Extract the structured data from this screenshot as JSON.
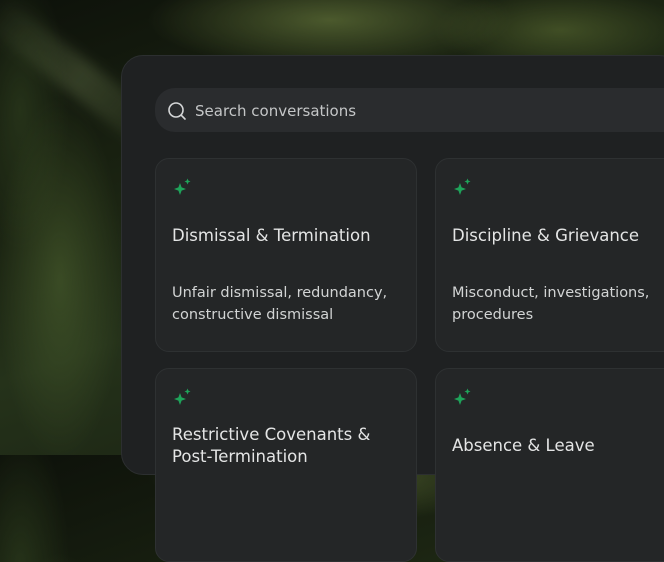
{
  "search": {
    "placeholder": "Search conversations"
  },
  "topics": [
    {
      "title": "Dismissal & Termination",
      "description": "Unfair dismissal, redundancy, constructive dismissal",
      "icon": "sparkle-icon"
    },
    {
      "title": "Discipline & Grievance",
      "description": "Misconduct, investigations, procedures",
      "icon": "sparkle-icon"
    },
    {
      "title": "Restrictive Covenants & Post-Termination",
      "description": "",
      "icon": "sparkle-icon"
    },
    {
      "title": "Absence & Leave",
      "description": "",
      "icon": "sparkle-icon"
    }
  ],
  "colors": {
    "accent": "#1fa35a",
    "panel": "#1f2122",
    "card": "#242627"
  }
}
